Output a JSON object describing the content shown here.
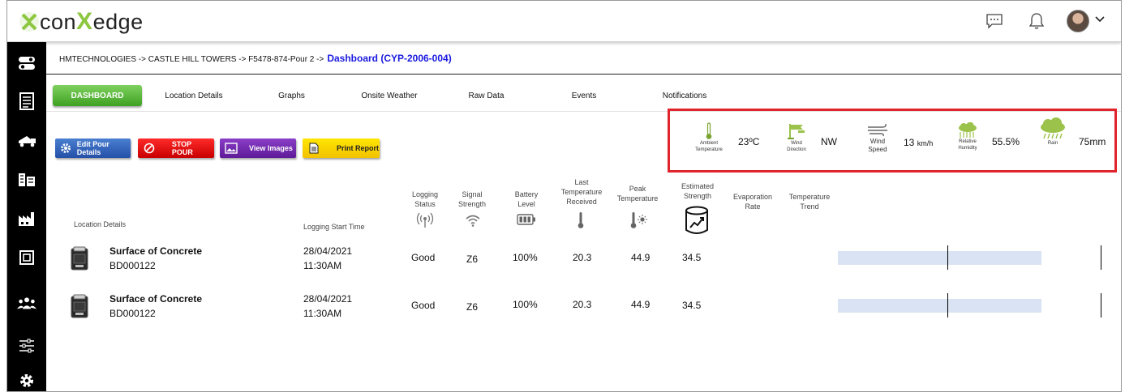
{
  "header": {
    "logo_prefix": "con",
    "logo_x": "X",
    "logo_suffix": "edge",
    "icons": [
      "chat-icon",
      "bell-icon",
      "avatar",
      "chevron-down-icon"
    ]
  },
  "sidebar": {
    "items": [
      {
        "icon": "toggle-icon"
      },
      {
        "icon": "list-icon"
      },
      {
        "icon": "concrete-truck-icon"
      },
      {
        "icon": "buildings-icon"
      },
      {
        "icon": "factory-icon"
      },
      {
        "icon": "chip-icon"
      },
      {
        "icon": "users-icon"
      },
      {
        "icon": "sliders-icon"
      },
      {
        "icon": "gear-icon"
      }
    ]
  },
  "breadcrumb": {
    "path": "HMTECHNOLOGIES -> CASTLE HILL TOWERS -> F5478-874-Pour 2 ->",
    "current": "Dashboard (CYP-2006-004)"
  },
  "tabs": [
    {
      "label": "DASHBOARD",
      "active": true
    },
    {
      "label": "Location Details"
    },
    {
      "label": "Graphs"
    },
    {
      "label": "Onsite Weather"
    },
    {
      "label": "Raw Data"
    },
    {
      "label": "Events"
    },
    {
      "label": "Notifications"
    }
  ],
  "actions": {
    "edit": "Edit Pour Details",
    "stop": "STOP POUR",
    "images": "View Images",
    "print": "Print Report"
  },
  "weather": {
    "ambient": {
      "caption1": "Ambient",
      "caption2": "Temperature",
      "value": "23ºC"
    },
    "wind_dir": {
      "caption1": "Wind",
      "caption2": "Direction",
      "value": "NW"
    },
    "wind_speed": {
      "caption1": "Wind",
      "caption2": "Speed",
      "value": "13",
      "unit": "km/h"
    },
    "humidity": {
      "caption1": "Relative",
      "caption2": "Humidity",
      "value": "55.5%"
    },
    "rain": {
      "caption": "Rain",
      "value": "75mm"
    },
    "colors": {
      "accent": "#8dc63f",
      "border": "#e0242b"
    }
  },
  "table": {
    "headers": {
      "location": "Location Details",
      "start": "Logging Start Time",
      "status": [
        "Logging",
        "Status"
      ],
      "signal": [
        "Signal",
        "Strength"
      ],
      "battery": [
        "Battery",
        "Level"
      ],
      "last_temp": [
        "Last",
        "Temperature",
        "Received"
      ],
      "peak": [
        "Peak",
        "Temperature"
      ],
      "strength": [
        "Estimated",
        "Strength"
      ],
      "evap": [
        "Evaporation",
        "Rate"
      ],
      "trend": [
        "Temperature",
        "Trend"
      ]
    },
    "rows": [
      {
        "name": "Surface of Concrete",
        "code": "BD000122",
        "date": "28/04/2021",
        "time": "11:30AM",
        "status": "Good",
        "signal": "Z6",
        "battery": "100%",
        "last_temp": "20.3",
        "peak": "44.9",
        "strength": "34.5",
        "trend_fraction": 0.77
      },
      {
        "name": "Surface of Concrete",
        "code": "BD000122",
        "date": "28/04/2021",
        "time": "11:30AM",
        "status": "Good",
        "signal": "Z6",
        "battery": "100%",
        "last_temp": "20.3",
        "peak": "44.9",
        "strength": "34.5",
        "trend_fraction": 0.77
      }
    ]
  }
}
